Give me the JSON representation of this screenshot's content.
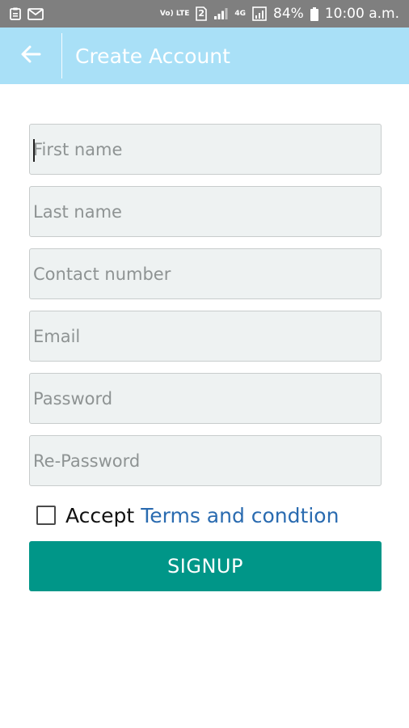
{
  "status_bar": {
    "volte_label": "Vo) LTE",
    "sim_label": "2",
    "network_label": "4G",
    "battery_percent": "84%",
    "time": "10:00 a.m."
  },
  "app_bar": {
    "title": "Create Account",
    "back_icon": "arrow-left-icon"
  },
  "form": {
    "fields": [
      {
        "placeholder": "First name",
        "value": ""
      },
      {
        "placeholder": "Last name",
        "value": ""
      },
      {
        "placeholder": "Contact number",
        "value": ""
      },
      {
        "placeholder": "Email",
        "value": ""
      },
      {
        "placeholder": "Password",
        "value": ""
      },
      {
        "placeholder": "Re-Password",
        "value": ""
      }
    ],
    "terms": {
      "checked": false,
      "accept_label": "Accept",
      "link_label": "Terms and condtion"
    },
    "submit_label": "SIGNUP"
  },
  "colors": {
    "status_bar_bg": "#7f7f7f",
    "app_bar_bg": "#a9e0f7",
    "field_bg": "#eef2f2",
    "button_bg": "#009688",
    "link": "#2a6bb0"
  }
}
